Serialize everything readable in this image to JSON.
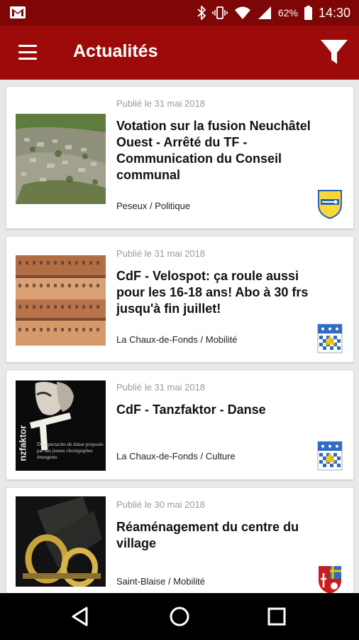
{
  "status_bar": {
    "battery": "62%",
    "time": "14:30",
    "icons": [
      "gmail-icon",
      "bluetooth-icon",
      "vibrate-icon",
      "wifi-icon",
      "signal-icon",
      "battery-icon"
    ]
  },
  "app_bar": {
    "title": "Actualités",
    "menu_icon": "hamburger-menu-icon",
    "filter_icon": "filter-funnel-icon"
  },
  "colors": {
    "status_bar": "#7f0606",
    "app_bar": "#9c0a0a",
    "background": "#e9e9e9"
  },
  "articles": [
    {
      "date": "Publié le 31 mai 2018",
      "title": "Votation sur la fusion Neuchâtel Ouest - Arrêté du TF - Communication du Conseil communal",
      "meta": "Peseux / Politique",
      "crest": "peseux-crest-icon"
    },
    {
      "date": "Publié le 31 mai 2018",
      "title": "CdF - Velospot: ça roule aussi pour les 16-18 ans! Abo à 30 frs jusqu'à fin juillet!",
      "meta": "La Chaux-de-Fonds / Mobilité",
      "crest": "chaux-de-fonds-crest-icon"
    },
    {
      "date": "Publié le 31 mai 2018",
      "title": "CdF - Tanzfaktor - Danse",
      "meta": "La Chaux-de-Fonds / Culture",
      "crest": "chaux-de-fonds-crest-icon",
      "thumb_text": {
        "vertical": "nzfaktor",
        "caption": "Des spectacles de danse proposés par des jeunes chorégraphes émergents"
      }
    },
    {
      "date": "Publié le 30 mai 2018",
      "title": "Réaménagement du centre du village",
      "meta": "Saint-Blaise / Mobilité",
      "crest": "saint-blaise-crest-icon"
    }
  ],
  "nav_bar": {
    "back_icon": "back-triangle-icon",
    "home_icon": "home-circle-icon",
    "recents_icon": "recents-square-icon"
  }
}
